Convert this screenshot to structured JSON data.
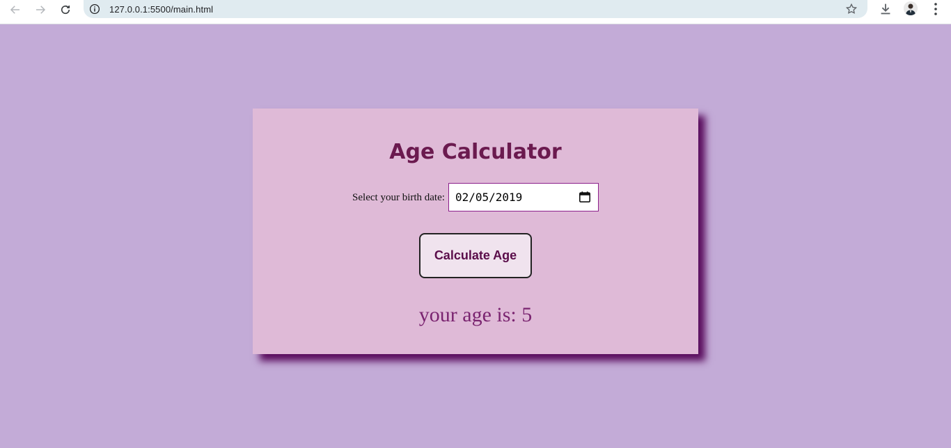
{
  "browser": {
    "url": "127.0.0.1:5500/main.html",
    "icons": {
      "back": "back-arrow-icon",
      "forward": "forward-arrow-icon",
      "reload": "reload-icon",
      "info": "info-icon",
      "bookmark": "star-icon",
      "download": "download-icon",
      "menu": "kebab-menu-icon"
    }
  },
  "page": {
    "background_color": "#c3abd7",
    "card_color": "#dfbad7",
    "shadow_color": "#5a0d5e"
  },
  "calculator": {
    "title": "Age Calculator",
    "birth_label": "Select your birth date:",
    "birth_date_value": "02/05/2019",
    "calculate_button_label": "Calculate Age",
    "result_text": "your age is: 5"
  }
}
